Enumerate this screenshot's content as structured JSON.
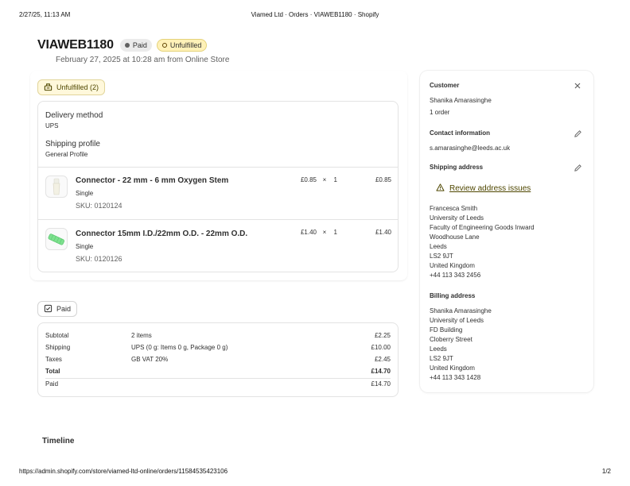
{
  "print": {
    "date": "2/27/25, 11:13 AM",
    "title": "Viamed Ltd · Orders · VIAWEB1180 · Shopify",
    "url": "https://admin.shopify.com/store/viamed-ltd-online/orders/11584535423106",
    "page": "1/2"
  },
  "order": {
    "name": "VIAWEB1180",
    "payment_badge": "Paid",
    "fulfillment_badge": "Unfulfilled",
    "subtitle": "February 27, 2025 at 10:28 am from Online Store"
  },
  "fulfillment": {
    "status_label": "Unfulfilled (2)",
    "delivery_method_label": "Delivery method",
    "delivery_method_value": "UPS",
    "shipping_profile_label": "Shipping profile",
    "shipping_profile_value": "General Profile",
    "items": [
      {
        "name": "Connector - 22 mm - 6 mm Oxygen Stem",
        "variant": "Single",
        "sku": "SKU: 0120124",
        "price": "£0.85",
        "times": "×",
        "qty": "1",
        "total": "£0.85",
        "thumb_icon": "white-connector-icon"
      },
      {
        "name": "Connector 15mm I.D./22mm O.D. - 22mm O.D.",
        "variant": "Single",
        "sku": "SKU: 0120126",
        "price": "£1.40",
        "times": "×",
        "qty": "1",
        "total": "£1.40",
        "thumb_icon": "green-connector-icon"
      }
    ]
  },
  "payment": {
    "status_label": "Paid",
    "rows": [
      {
        "label": "Subtotal",
        "detail": "2 items",
        "amount": "£2.25"
      },
      {
        "label": "Shipping",
        "detail": "UPS (0 g: Items 0 g, Package 0 g)",
        "amount": "£10.00"
      },
      {
        "label": "Taxes",
        "detail": "GB VAT 20%",
        "amount": "£2.45"
      },
      {
        "label": "Total",
        "detail": "",
        "amount": "£14.70"
      },
      {
        "label": "Paid",
        "detail": "",
        "amount": "£14.70"
      }
    ]
  },
  "customer": {
    "title": "Customer",
    "name": "Shanika Amarasinghe",
    "orders": "1 order",
    "contact_title": "Contact information",
    "email": "s.amarasinghe@leeds.ac.uk",
    "shipping_title": "Shipping address",
    "review_link": "Review address issues",
    "shipping_lines": [
      "Francesca Smith",
      "University of Leeds",
      "Faculty of Engineering Goods Inward",
      "Woodhouse Lane",
      "Leeds",
      "LS2 9JT",
      "United Kingdom",
      "+44 113 343 2456"
    ],
    "billing_title": "Billing address",
    "billing_lines": [
      "Shanika Amarasinghe",
      "University of Leeds",
      "FD Building",
      "Cloberry Street",
      "Leeds",
      "LS2 9JT",
      "United Kingdom",
      "+44 113 343 1428"
    ]
  },
  "timeline": {
    "title": "Timeline"
  },
  "colors": {
    "unfulfilled_bg": "#fff1b8",
    "warning_text": "#4f4700",
    "border": "#e3e3e3"
  }
}
